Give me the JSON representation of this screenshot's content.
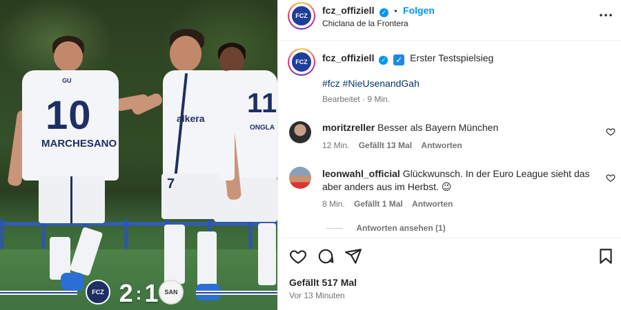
{
  "photo": {
    "players": [
      {
        "number": "10",
        "name": "MARCHESANO",
        "name_top": "GU"
      },
      {
        "number": "7",
        "shirt_text": "alkera"
      },
      {
        "number": "11",
        "name": "ONGLA"
      }
    ],
    "score": {
      "home": "2",
      "away": "1",
      "separator": ":"
    },
    "home_crest": "FCZ",
    "away_crest": "SAN"
  },
  "post": {
    "header": {
      "username": "fcz_offiziell",
      "dot": "•",
      "follow_label": "Folgen",
      "location": "Chiclana de la Frontera",
      "more_icon": "more-icon"
    },
    "caption": {
      "username": "fcz_offiziell",
      "text": "Erster Testspielsieg",
      "emoji": "✓",
      "hashtags": "#fcz #NieUsenandGah",
      "meta": "Bearbeitet · 9 Min."
    },
    "comments": [
      {
        "username": "moritzreller",
        "text": "Besser als Bayern München",
        "time": "12 Min.",
        "likes": "Gefällt 13 Mal",
        "reply": "Antworten"
      },
      {
        "username": "leonwahl_official",
        "text": "Glückwunsch. In der Euro League sieht das aber anders aus im Herbst. 😉",
        "time": "8 Min.",
        "likes": "Gefällt 1 Mal",
        "reply": "Antworten"
      }
    ],
    "view_replies": "Antworten ansehen (1)",
    "likes": "Gefällt 517 Mal",
    "time": "Vor 13 Minuten"
  },
  "colors": {
    "accent": "#0095f6",
    "hashtag": "#00376b",
    "secondary_text": "#737373",
    "club_blue": "#1f3e9b"
  }
}
